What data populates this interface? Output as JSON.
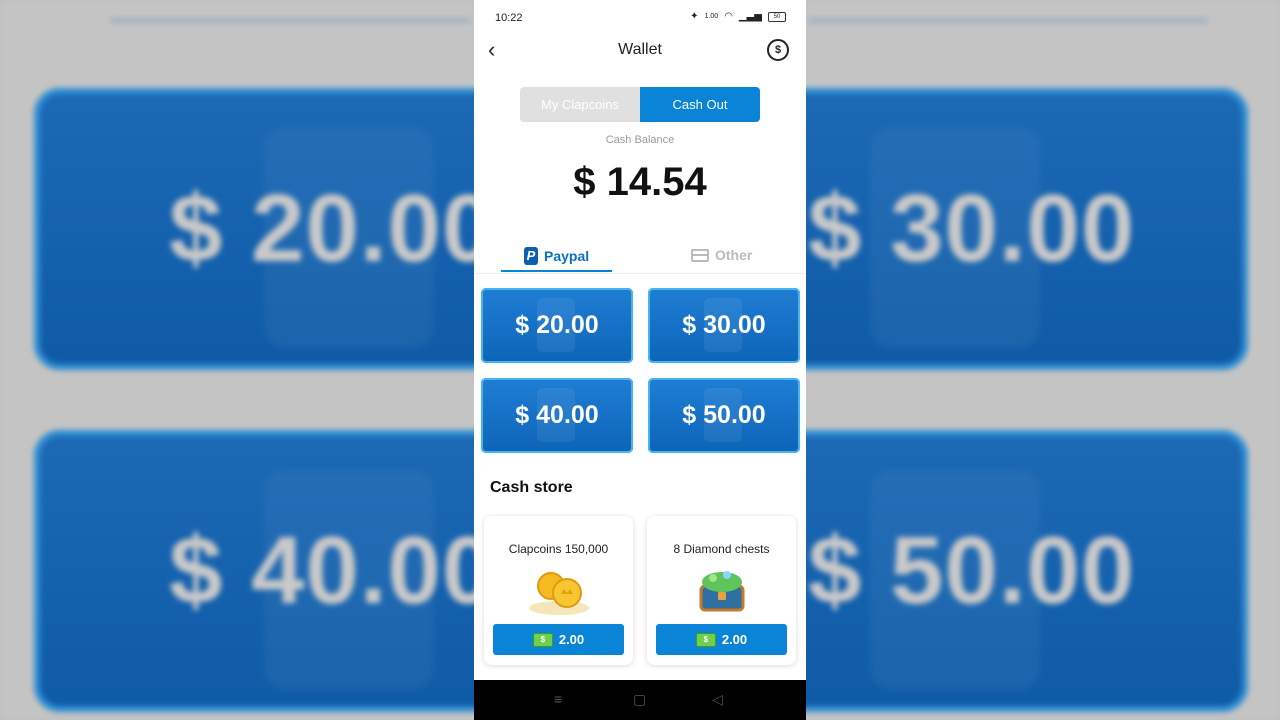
{
  "status_bar": {
    "time": "10:22",
    "speed": "1.00",
    "battery": "50"
  },
  "header": {
    "title": "Wallet"
  },
  "segment": {
    "left": "My Clapcoins",
    "right": "Cash Out"
  },
  "balance": {
    "label": "Cash Balance",
    "amount": "$ 14.54"
  },
  "tabs": {
    "paypal": "Paypal",
    "other": "Other"
  },
  "cashout_options": [
    "$ 20.00",
    "$ 30.00",
    "$ 40.00",
    "$ 50.00"
  ],
  "cash_store": {
    "title": "Cash store",
    "items": [
      {
        "name": "Clapcoins 150,000",
        "price": "2.00"
      },
      {
        "name": "8 Diamond chests",
        "price": "2.00"
      }
    ]
  },
  "background": {
    "amounts": [
      "$ 20.00",
      "$ 30.00",
      "$ 40.00",
      "$ 50.00"
    ]
  },
  "colors": {
    "accent": "#0a84d6",
    "card_blue": "#0d64b8"
  }
}
